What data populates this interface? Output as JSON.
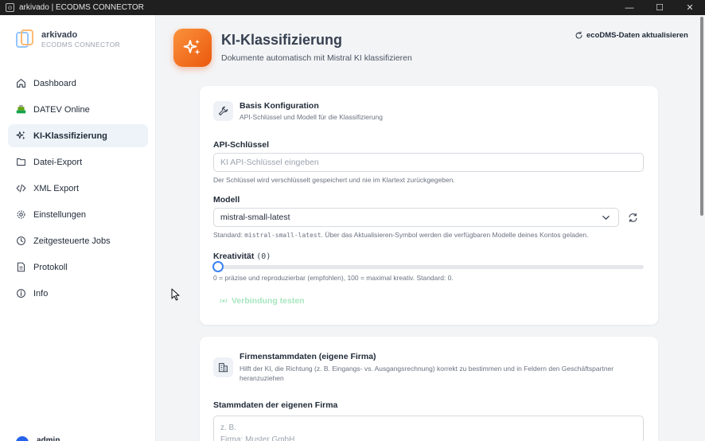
{
  "window": {
    "title": "arkivado | ECODMS CONNECTOR"
  },
  "brand": {
    "name": "arkivado",
    "subtitle": "ECODMS CONNECTOR"
  },
  "sidebar": {
    "items": [
      {
        "label": "Dashboard",
        "icon": "home-icon"
      },
      {
        "label": "DATEV Online",
        "icon": "datev-icon"
      },
      {
        "label": "KI-Klassifizierung",
        "icon": "sparkles-icon",
        "active": true
      },
      {
        "label": "Datei-Export",
        "icon": "file-icon"
      },
      {
        "label": "XML Export",
        "icon": "code-icon"
      },
      {
        "label": "Einstellungen",
        "icon": "gear-icon"
      },
      {
        "label": "Zeitgesteuerte Jobs",
        "icon": "clock-icon"
      },
      {
        "label": "Protokoll",
        "icon": "document-icon"
      },
      {
        "label": "Info",
        "icon": "info-icon"
      }
    ],
    "user": "admin"
  },
  "header": {
    "title": "KI-Klassifizierung",
    "subtitle": "Dokumente automatisch mit Mistral KI klassifizieren",
    "refresh_label": "ecoDMS-Daten aktualisieren"
  },
  "basis": {
    "title": "Basis Konfiguration",
    "description": "API-Schlüssel und Modell für die Klassifizierung",
    "api_key_label": "API-Schlüssel",
    "api_key_placeholder": "KI API-Schlüssel eingeben",
    "api_key_value": "",
    "api_key_hint": "Der Schlüssel wird verschlüsselt gespeichert und nie im Klartext zurückgegeben.",
    "model_label": "Modell",
    "model_value": "mistral-small-latest",
    "model_hint_prefix": "Standard: ",
    "model_hint_code": "mistral-small-latest",
    "model_hint_suffix": ". Über das Aktualisieren-Symbol werden die verfügbaren Modelle deines Kontos geladen.",
    "creativity_label": "Kreativität",
    "creativity_value": "(0)",
    "creativity_level": 0,
    "creativity_hint": "0 = präzise und reproduzierbar (empfohlen), 100 = maximal kreativ. Standard: 0.",
    "test_button": "Verbindung testen"
  },
  "company": {
    "title": "Firmenstammdaten (eigene Firma)",
    "description": "Hilft der KI, die Richtung (z. B. Eingangs- vs. Ausgangsrechnung) korrekt zu bestimmen und in Feldern den Geschäftspartner heranzuziehen",
    "field_label": "Stammdaten der eigenen Firma",
    "placeholder_line1": "z. B.",
    "placeholder_line2": "Firma: Muster GmbH"
  },
  "colors": {
    "accent": "#f97316",
    "active_nav": "#eef3fa",
    "slider": "#3b82f6",
    "test_button_disabled": "#a7e6bf"
  }
}
